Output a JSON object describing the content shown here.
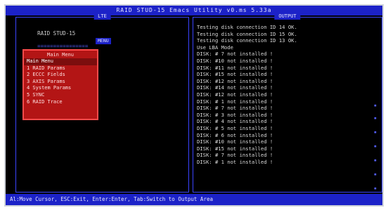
{
  "window": {
    "title": "RAID STUD-15 Emacs Utility v0.ms 5.33a"
  },
  "panes": {
    "left_label": "LTE",
    "right_label": "OUTPUT"
  },
  "left_header": {
    "text": "RAID STUD-15",
    "bar": "================"
  },
  "submenu_label": "MENU",
  "menu": {
    "title": "Main Menu",
    "items": [
      {
        "label": "Main Menu"
      },
      {
        "label": "1 RAID Params"
      },
      {
        "label": "2 ECCC Fields"
      },
      {
        "label": "3 AXIS Params"
      },
      {
        "label": "4 System Params"
      },
      {
        "label": "5 SYNC"
      },
      {
        "label": "6 RAID Trace"
      }
    ]
  },
  "log": [
    "Testing disk connection ID 14 OK.",
    "Testing disk connection ID 15 OK.",
    "Testing disk connection ID 13 OK.",
    "Use LBA Mode",
    "DISK: # 7 not installed !",
    "DISK: #10 not installed !",
    "DISK: #11 not installed !",
    "DISK: #15 not installed !",
    "DISK: #12 not installed !",
    "DISK: #14 not installed !",
    "DISK: #12 not installed !",
    "DISK: # 1 not installed !",
    "DISK: # 7 not installed !",
    "DISK: # 3 not installed !",
    "DISK: # 4 not installed !",
    "DISK: # 5 not installed !",
    "DISK: # 6 not installed !",
    "DISK: #10 not installed !",
    "DISK: #15 not installed !",
    "DISK: # 7 not installed !",
    "DISK: # 1 not installed !"
  ],
  "status_bar": {
    "text": "Al:Move Cursor, ESC:Exit, Enter:Enter, Tab:Switch to Output Area"
  },
  "colors": {
    "accent_blue": "#1c22c8",
    "menu_red": "#b31515",
    "menu_border": "#ff4b4b"
  }
}
